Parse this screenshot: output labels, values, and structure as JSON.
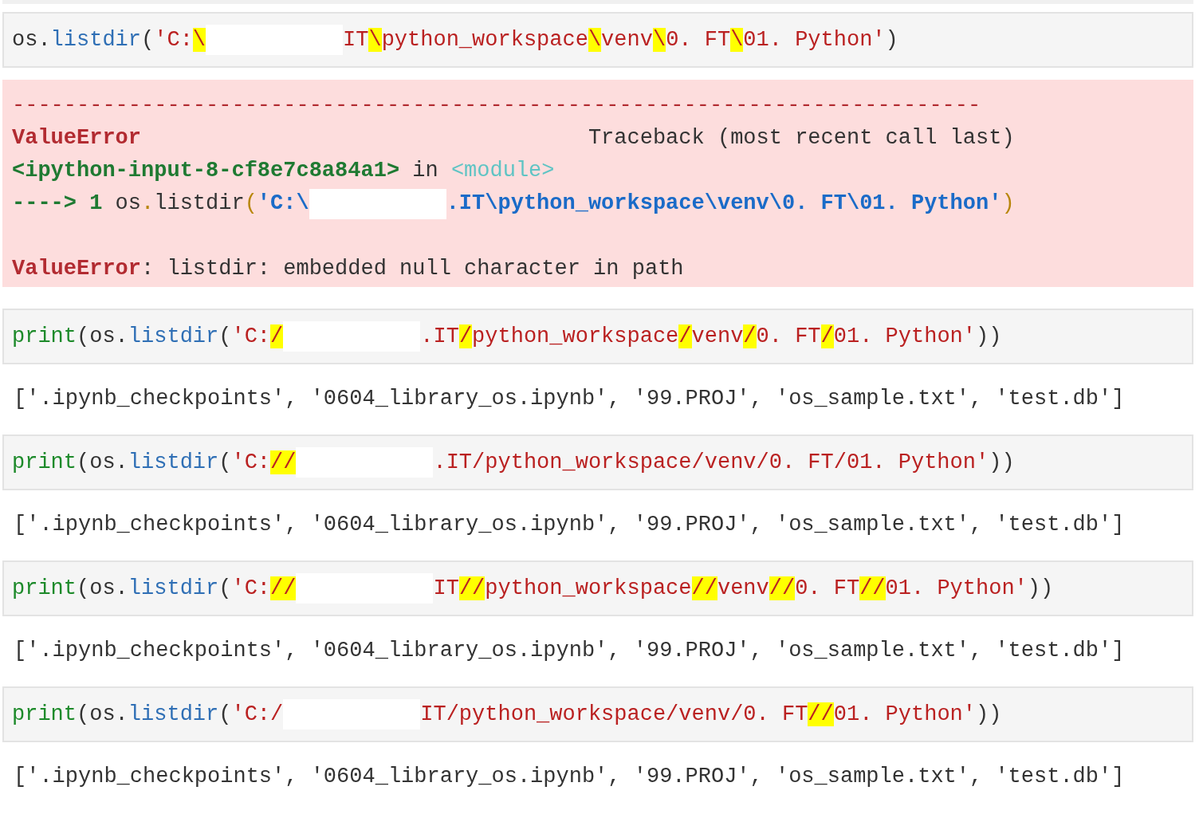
{
  "cells": [
    {
      "kind": "code",
      "tokens": [
        {
          "text": "os.",
          "kind": "plain"
        },
        {
          "text": "listdir",
          "kind": "name"
        },
        {
          "text": "(",
          "kind": "plain"
        },
        {
          "text": "'C:",
          "kind": "string"
        },
        {
          "text": "\\",
          "kind": "string",
          "highlighted": true
        },
        {
          "kind": "redaction"
        },
        {
          "text": "IT",
          "kind": "string"
        },
        {
          "text": "\\",
          "kind": "string",
          "highlighted": true
        },
        {
          "text": "python_workspace",
          "kind": "string"
        },
        {
          "text": "\\",
          "kind": "string",
          "highlighted": true
        },
        {
          "text": "venv",
          "kind": "string"
        },
        {
          "text": "\\",
          "kind": "string",
          "highlighted": true
        },
        {
          "text": "0. FT",
          "kind": "string"
        },
        {
          "text": "\\",
          "kind": "string",
          "highlighted": true
        },
        {
          "text": "01. Python'",
          "kind": "string"
        },
        {
          "text": ")",
          "kind": "plain"
        }
      ]
    },
    {
      "kind": "error",
      "lines": [
        {
          "kind": "trace",
          "tokens": [
            {
              "text": "---------------------------------------------------------------------------",
              "kind": "dash"
            }
          ]
        },
        {
          "kind": "trace",
          "tokens": [
            {
              "text": "ValueError",
              "kind": "err"
            }
          ],
          "right": [
            {
              "text": "Traceback (most recent call last)",
              "kind": "plain"
            }
          ]
        },
        {
          "kind": "trace",
          "tokens": [
            {
              "text": "<ipython-input-8-cf8e7c8a84a1>",
              "kind": "loc"
            },
            {
              "text": " in ",
              "kind": "plain"
            },
            {
              "text": "<module>",
              "kind": "module"
            }
          ]
        },
        {
          "kind": "trace",
          "tokens": [
            {
              "text": "----> 1",
              "kind": "loc"
            },
            {
              "text": " os",
              "kind": "plain"
            },
            {
              "text": ".",
              "kind": "paren"
            },
            {
              "text": "listdir",
              "kind": "plain"
            },
            {
              "text": "(",
              "kind": "paren"
            },
            {
              "text": "'C:\\",
              "kind": "estr"
            },
            {
              "kind": "redaction"
            },
            {
              "text": ".IT\\python_workspace\\venv\\0. FT\\01. Python'",
              "kind": "estr"
            },
            {
              "text": ")",
              "kind": "paren"
            }
          ]
        },
        {
          "kind": "message",
          "tokens": [
            {
              "text": "ValueError",
              "kind": "err"
            },
            {
              "text": ": listdir: embedded null character in path",
              "kind": "plain"
            }
          ]
        }
      ]
    },
    {
      "kind": "code",
      "tokens": [
        {
          "text": "print",
          "kind": "builtin"
        },
        {
          "text": "(os.",
          "kind": "plain"
        },
        {
          "text": "listdir",
          "kind": "name"
        },
        {
          "text": "(",
          "kind": "plain"
        },
        {
          "text": "'C:",
          "kind": "string"
        },
        {
          "text": "/",
          "kind": "string",
          "highlighted": true
        },
        {
          "kind": "redaction"
        },
        {
          "text": ".IT",
          "kind": "string"
        },
        {
          "text": "/",
          "kind": "string",
          "highlighted": true
        },
        {
          "text": "python_workspace",
          "kind": "string"
        },
        {
          "text": "/",
          "kind": "string",
          "highlighted": true
        },
        {
          "text": "venv",
          "kind": "string"
        },
        {
          "text": "/",
          "kind": "string",
          "highlighted": true
        },
        {
          "text": "0. FT",
          "kind": "string"
        },
        {
          "text": "/",
          "kind": "string",
          "highlighted": true
        },
        {
          "text": "01. Python'",
          "kind": "string"
        },
        {
          "text": "))",
          "kind": "plain"
        }
      ]
    },
    {
      "kind": "output",
      "text": "['.ipynb_checkpoints', '0604_library_os.ipynb', '99.PROJ', 'os_sample.txt', 'test.db']"
    },
    {
      "kind": "code",
      "tokens": [
        {
          "text": "print",
          "kind": "builtin"
        },
        {
          "text": "(os.",
          "kind": "plain"
        },
        {
          "text": "listdir",
          "kind": "name"
        },
        {
          "text": "(",
          "kind": "plain"
        },
        {
          "text": "'C:",
          "kind": "string"
        },
        {
          "text": "//",
          "kind": "string",
          "highlighted": true
        },
        {
          "kind": "redaction"
        },
        {
          "text": ".IT/python_workspace/venv/0. FT/01. Python'",
          "kind": "string"
        },
        {
          "text": "))",
          "kind": "plain"
        }
      ]
    },
    {
      "kind": "output",
      "text": "['.ipynb_checkpoints', '0604_library_os.ipynb', '99.PROJ', 'os_sample.txt', 'test.db']"
    },
    {
      "kind": "code",
      "tokens": [
        {
          "text": "print",
          "kind": "builtin"
        },
        {
          "text": "(os.",
          "kind": "plain"
        },
        {
          "text": "listdir",
          "kind": "name"
        },
        {
          "text": "(",
          "kind": "plain"
        },
        {
          "text": "'C:",
          "kind": "string"
        },
        {
          "text": "//",
          "kind": "string",
          "highlighted": true
        },
        {
          "kind": "redaction"
        },
        {
          "text": "IT",
          "kind": "string"
        },
        {
          "text": "//",
          "kind": "string",
          "highlighted": true
        },
        {
          "text": "python_workspace",
          "kind": "string"
        },
        {
          "text": "//",
          "kind": "string",
          "highlighted": true
        },
        {
          "text": "venv",
          "kind": "string"
        },
        {
          "text": "//",
          "kind": "string",
          "highlighted": true
        },
        {
          "text": "0. FT",
          "kind": "string"
        },
        {
          "text": "//",
          "kind": "string",
          "highlighted": true
        },
        {
          "text": "01. Python'",
          "kind": "string"
        },
        {
          "text": "))",
          "kind": "plain"
        }
      ]
    },
    {
      "kind": "output",
      "text": "['.ipynb_checkpoints', '0604_library_os.ipynb', '99.PROJ', 'os_sample.txt', 'test.db']"
    },
    {
      "kind": "code",
      "tokens": [
        {
          "text": "print",
          "kind": "builtin"
        },
        {
          "text": "(os.",
          "kind": "plain"
        },
        {
          "text": "listdir",
          "kind": "name"
        },
        {
          "text": "(",
          "kind": "plain"
        },
        {
          "text": "'C:/",
          "kind": "string"
        },
        {
          "kind": "redaction"
        },
        {
          "text": "IT/python_workspace/venv/0. FT",
          "kind": "string"
        },
        {
          "text": "//",
          "kind": "string",
          "highlighted": true
        },
        {
          "text": "01. Python'",
          "kind": "string"
        },
        {
          "text": "))",
          "kind": "plain"
        }
      ]
    },
    {
      "kind": "output",
      "text": "['.ipynb_checkpoints', '0604_library_os.ipynb', '99.PROJ', 'os_sample.txt', 'test.db']"
    }
  ]
}
